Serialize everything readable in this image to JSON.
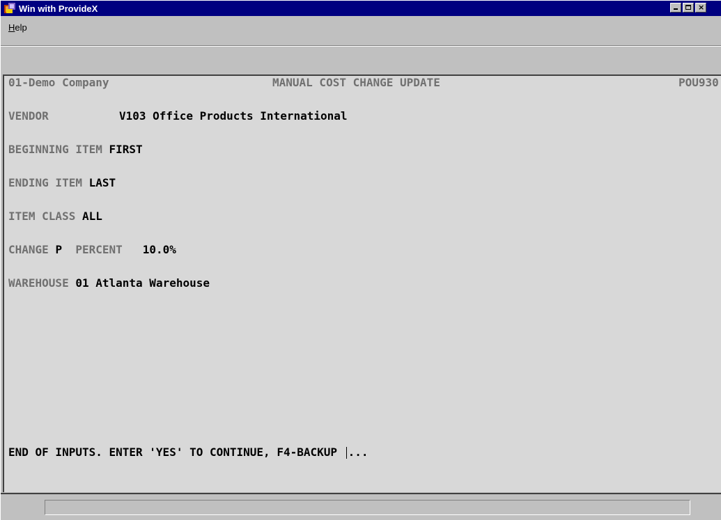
{
  "window": {
    "title": "Win with ProvideX",
    "icon": "providex-app-icon",
    "controls": [
      "minimize",
      "maximize",
      "close"
    ]
  },
  "menu": {
    "items": [
      {
        "label": "Help",
        "mnemonic": "H"
      }
    ]
  },
  "screen": {
    "company": "01-Demo Company",
    "heading": "MANUAL COST CHANGE UPDATE",
    "program_id": "POU930",
    "vendor": {
      "label": "VENDOR",
      "value": "V103 Office Products International"
    },
    "beginning_item": {
      "label": "BEGINNING ITEM",
      "value": "FIRST"
    },
    "ending_item": {
      "label": "ENDING ITEM",
      "value": "LAST"
    },
    "item_class": {
      "label": "ITEM CLASS",
      "value": "ALL"
    },
    "change": {
      "label": "CHANGE",
      "value": "P",
      "type_label": "PERCENT",
      "amount": "10.0%"
    },
    "warehouse": {
      "label": "WAREHOUSE",
      "value": "01 Atlanta Warehouse"
    },
    "prompt": {
      "text": "END OF INPUTS. ENTER 'YES' TO CONTINUE, F4-BACKUP",
      "input_value": "..."
    }
  },
  "status": {
    "text": ""
  },
  "colors": {
    "titlebar": "#000080",
    "window_face": "#c0c0c0",
    "terminal_bg": "#d8d8d8",
    "label_gray": "#707070",
    "value_black": "#000000"
  }
}
